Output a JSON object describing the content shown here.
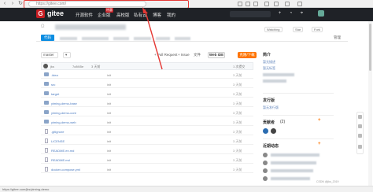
{
  "browser": {
    "url_text": "https://gitee.com/"
  },
  "header": {
    "logo": "gitee",
    "nav": [
      "开源软件",
      "企业版",
      "高校版",
      "私有云",
      "博客",
      "我的"
    ],
    "badge": "特惠"
  },
  "repo": {
    "title_prefix": "Ω",
    "watch_label": "Watching",
    "star_label": "Star",
    "fork_label": "Fork"
  },
  "tabs": [
    "代码",
    "Issues",
    "Pull Requests",
    "Wiki",
    "统计",
    "流水线",
    "服务",
    "管理"
  ],
  "toolbar": {
    "branch": "master",
    "pull_request": "+ Pull Request",
    "issue": "+ Issue",
    "file_menu": "文件",
    "webide": "Web IDE",
    "clone": "克隆/下载"
  },
  "commit": {
    "author": "jks",
    "hash": "7c8f45e",
    "when": "3 天前",
    "count": "1 次提交"
  },
  "files": [
    {
      "name": ".idea",
      "type": "folder",
      "msg": "init",
      "time": "3 天前"
    },
    {
      "name": "src",
      "type": "folder",
      "msg": "init",
      "time": "3 天前"
    },
    {
      "name": "target",
      "type": "folder",
      "msg": "init",
      "time": "3 天前"
    },
    {
      "name": "yiming-demo-base",
      "type": "folder",
      "msg": "init",
      "time": "3 天前"
    },
    {
      "name": "yiming-demo-core",
      "type": "folder",
      "msg": "init",
      "time": "3 天前"
    },
    {
      "name": "yiming-demo-web",
      "type": "folder",
      "msg": "init",
      "time": "3 天前"
    },
    {
      "name": ".gitignore",
      "type": "file",
      "msg": "init",
      "time": "3 天前"
    },
    {
      "name": "LICENSE",
      "type": "file",
      "msg": "init",
      "time": "3 天前"
    },
    {
      "name": "README.en.md",
      "type": "file",
      "msg": "init",
      "time": "3 天前"
    },
    {
      "name": "README.md",
      "type": "file",
      "msg": "init",
      "time": "3 天前"
    },
    {
      "name": "docker-compose.yml",
      "type": "file",
      "msg": "init",
      "time": "3 天前"
    }
  ],
  "sidebar": {
    "intro_title": "简介",
    "intro_lines": [
      "暂无描述",
      "暂无标签"
    ],
    "releases_title": "发行版",
    "releases_text": "暂无发行版",
    "contrib_title": "贡献者",
    "contrib_count": "(2)",
    "activity_title": "近期动态",
    "plus": "+"
  },
  "status_url": "https://gitee.com/jks/yiming-demo",
  "watermark": "CSDN @jks_2019"
}
